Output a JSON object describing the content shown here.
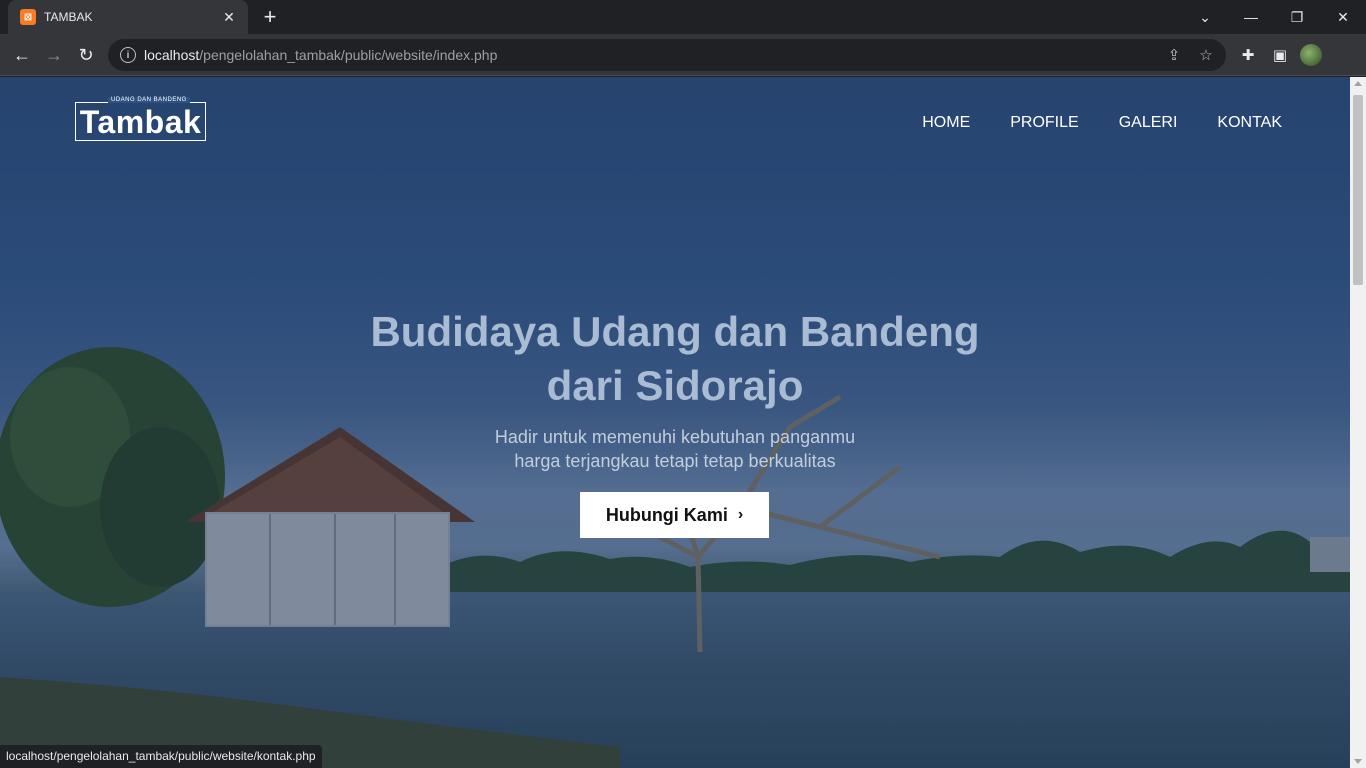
{
  "browser": {
    "tab_title": "TAMBAK",
    "favicon_glyph": "⊠",
    "new_tab": "+",
    "url_host": "localhost",
    "url_path": "/pengelolahan_tambak/public/website/index.php",
    "status_url": "localhost/pengelolahan_tambak/public/website/kontak.php"
  },
  "site": {
    "logo_small": "UDANG DAN BANDENG",
    "logo_big": "Tambak",
    "nav": [
      {
        "label": "HOME"
      },
      {
        "label": "PROFILE"
      },
      {
        "label": "GALERI"
      },
      {
        "label": "KONTAK"
      }
    ]
  },
  "hero": {
    "title_line1": "Budidaya Udang dan Bandeng",
    "title_line2": "dari Sidorajo",
    "subtitle_line1": "Hadir untuk memenuhi kebutuhan panganmu",
    "subtitle_line2": "harga terjangkau tetapi tetap berkualitas",
    "cta_label": "Hubungi Kami",
    "cta_chevron": "›"
  },
  "colors": {
    "chrome_dark": "#202124",
    "chrome_toolbar": "#35363a",
    "hero_blue": "#2c4f7a",
    "favicon": "#fb7a24"
  }
}
